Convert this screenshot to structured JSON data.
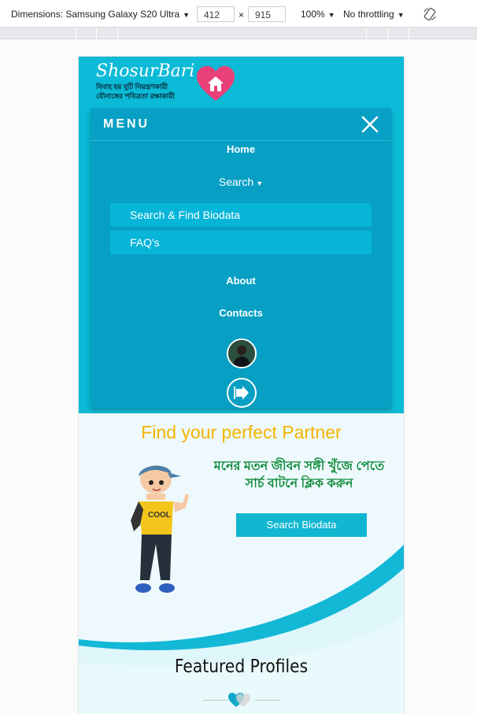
{
  "devtools": {
    "dimensions_label": "Dimensions: Samsung Galaxy S20 Ultra",
    "width": "412",
    "times": "×",
    "height": "915",
    "zoom": "100%",
    "throttling": "No throttling",
    "icon": "rotate-icon"
  },
  "logo": {
    "brand": "ShosurBari",
    "tagline_1": "বিবাহ হয় দুটি নিয়ন্ত্রণকারী",
    "tagline_2": "যৌনাঙ্গের পবিত্রতা রক্ষাকারী"
  },
  "menu": {
    "title": "MENU",
    "close_icon": "close-icon",
    "items": [
      {
        "label": "Home"
      },
      {
        "label": "Search"
      },
      {
        "label": "About"
      },
      {
        "label": "Contacts"
      }
    ],
    "search_submenu": [
      {
        "label": "Search & Find Biodata"
      },
      {
        "label": "FAQ's"
      }
    ],
    "avatar_icon": "profile-avatar",
    "logout_icon": "logout-icon"
  },
  "hero": {
    "title": "Find your perfect Partner",
    "bangla_line_1": "মনের মতন জীবন সঙ্গী খুঁজে পেতে",
    "bangla_line_2": "সার্চ বাটনে ক্লিক করুন",
    "search_button": "Search Biodata"
  },
  "featured": {
    "title": "Featured Profiles",
    "icon": "heart-divider-icon"
  },
  "colors": {
    "primary": "#0bbad6",
    "menu_bg": "#089fc4",
    "accent_yellow": "#f2b400",
    "bangla_green": "#0f8a3a",
    "logo_pink": "#e9407a"
  }
}
